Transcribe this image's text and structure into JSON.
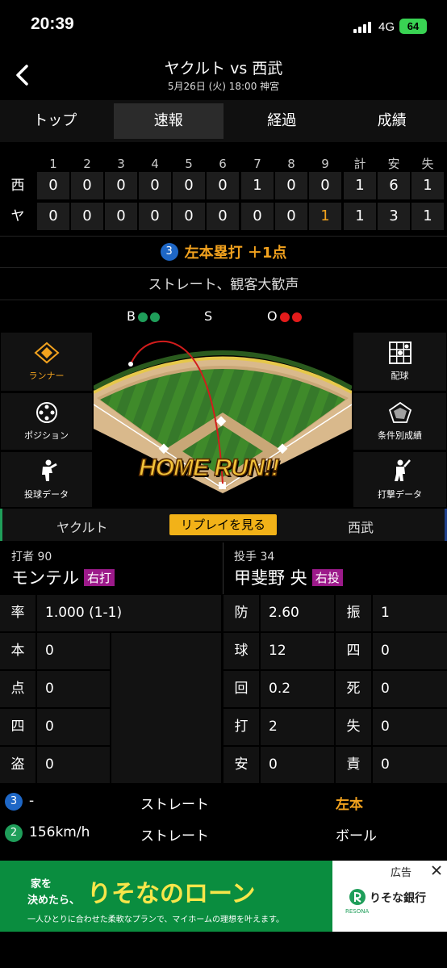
{
  "status": {
    "time": "20:39",
    "network": "4G",
    "battery": "64"
  },
  "header": {
    "title": "ヤクルト vs 西武",
    "subtitle": "5月26日 (火) 18:00 神宮"
  },
  "tabs": [
    "トップ",
    "速報",
    "経過",
    "成績"
  ],
  "scoreboard": {
    "headers": [
      "1",
      "2",
      "3",
      "4",
      "5",
      "6",
      "7",
      "8",
      "9",
      "計",
      "安",
      "失"
    ],
    "rows": [
      {
        "team": "西",
        "cells": [
          "0",
          "0",
          "0",
          "0",
          "0",
          "0",
          "1",
          "0",
          "0",
          "1",
          "6",
          "1"
        ]
      },
      {
        "team": "ヤ",
        "cells": [
          "0",
          "0",
          "0",
          "0",
          "0",
          "0",
          "0",
          "0",
          "1",
          "1",
          "3",
          "1"
        ]
      }
    ]
  },
  "result": {
    "num": "3",
    "text": "左本塁打 ＋1点"
  },
  "pitch_desc": "ストレート、観客大歓声",
  "count": {
    "b": "B",
    "s": "S",
    "o": "O"
  },
  "side_left": [
    "ランナー",
    "ポジション",
    "投球データ"
  ],
  "side_right": [
    "配球",
    "条件別成績",
    "打撃データ"
  ],
  "field": {
    "banner": "HOME RUN!!"
  },
  "teams": {
    "home": "ヤクルト",
    "replay": "リプレイを見る",
    "away": "西武"
  },
  "batter": {
    "label": "打者 90",
    "name": "モンテル",
    "hand": "右打"
  },
  "pitcher": {
    "label": "投手 34",
    "name": "甲斐野 央",
    "hand": "右投"
  },
  "batter_stats": [
    {
      "k": "率",
      "v": "1.000 (1-1)"
    },
    {
      "k": "本",
      "v": "0"
    },
    {
      "k": "点",
      "v": "0"
    },
    {
      "k": "四",
      "v": "0"
    },
    {
      "k": "盗",
      "v": "0"
    }
  ],
  "pitcher_stats": [
    {
      "k": "防",
      "v": "2.60",
      "k2": "振",
      "v2": "1"
    },
    {
      "k": "球",
      "v": "12",
      "k2": "四",
      "v2": "0"
    },
    {
      "k": "回",
      "v": "0.2",
      "k2": "死",
      "v2": "0"
    },
    {
      "k": "打",
      "v": "2",
      "k2": "失",
      "v2": "0"
    },
    {
      "k": "安",
      "v": "0",
      "k2": "責",
      "v2": "0"
    }
  ],
  "plays": [
    {
      "n": "3",
      "speed": "-",
      "type": "ストレート",
      "result": "左本",
      "color": "#1e67c6"
    },
    {
      "n": "2",
      "speed": "156km/h",
      "type": "ストレート",
      "result": "ボール",
      "color": "#1f9e5a"
    }
  ],
  "ad": {
    "label": "広告",
    "line1a": "家を",
    "line1b": "決めたら、",
    "big": "りそなのローン",
    "line2": "一人ひとりに合わせた柔軟なプランで、マイホームの理想を叶えます。",
    "bank": "りそな銀行",
    "bank_sub": "RESONA"
  }
}
